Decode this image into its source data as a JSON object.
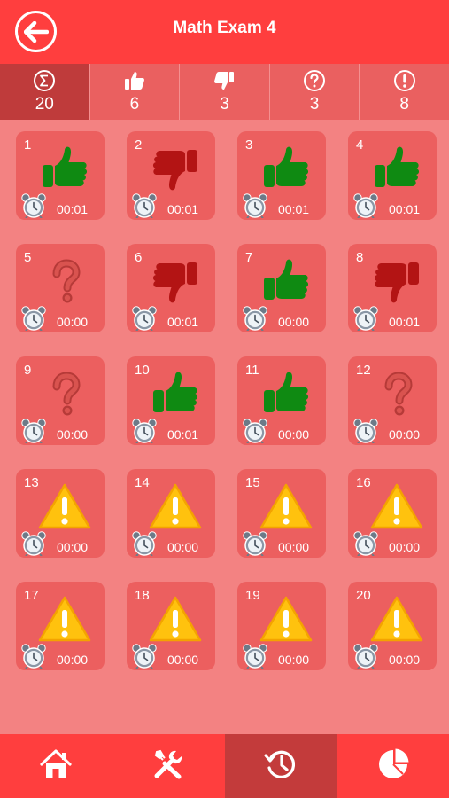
{
  "header": {
    "title": "Math Exam 4",
    "back_icon": "arrow-left-icon"
  },
  "stats": [
    {
      "icon": "sigma-icon",
      "count": "20",
      "active": true
    },
    {
      "icon": "thumbs-up-icon",
      "count": "6",
      "active": false
    },
    {
      "icon": "thumbs-down-icon",
      "count": "3",
      "active": false
    },
    {
      "icon": "question-icon",
      "count": "3",
      "active": false
    },
    {
      "icon": "exclamation-icon",
      "count": "8",
      "active": false
    }
  ],
  "questions": [
    {
      "number": "1",
      "status": "correct",
      "time": "00:01"
    },
    {
      "number": "2",
      "status": "wrong",
      "time": "00:01"
    },
    {
      "number": "3",
      "status": "correct",
      "time": "00:01"
    },
    {
      "number": "4",
      "status": "correct",
      "time": "00:01"
    },
    {
      "number": "5",
      "status": "unsure",
      "time": "00:00"
    },
    {
      "number": "6",
      "status": "wrong",
      "time": "00:01"
    },
    {
      "number": "7",
      "status": "correct",
      "time": "00:00"
    },
    {
      "number": "8",
      "status": "wrong",
      "time": "00:01"
    },
    {
      "number": "9",
      "status": "unsure",
      "time": "00:00"
    },
    {
      "number": "10",
      "status": "correct",
      "time": "00:01"
    },
    {
      "number": "11",
      "status": "correct",
      "time": "00:00"
    },
    {
      "number": "12",
      "status": "unsure",
      "time": "00:00"
    },
    {
      "number": "13",
      "status": "unanswered",
      "time": "00:00"
    },
    {
      "number": "14",
      "status": "unanswered",
      "time": "00:00"
    },
    {
      "number": "15",
      "status": "unanswered",
      "time": "00:00"
    },
    {
      "number": "16",
      "status": "unanswered",
      "time": "00:00"
    },
    {
      "number": "17",
      "status": "unanswered",
      "time": "00:00"
    },
    {
      "number": "18",
      "status": "unanswered",
      "time": "00:00"
    },
    {
      "number": "19",
      "status": "unanswered",
      "time": "00:00"
    },
    {
      "number": "20",
      "status": "unanswered",
      "time": "00:00"
    }
  ],
  "tabs": [
    {
      "icon": "home-icon",
      "active": false
    },
    {
      "icon": "tools-icon",
      "active": false
    },
    {
      "icon": "history-icon",
      "active": true
    },
    {
      "icon": "pie-chart-icon",
      "active": false
    }
  ],
  "colors": {
    "header": "#ff3e3e",
    "background": "#f38282",
    "card": "#ec5f5f",
    "correct": "#0f8a12",
    "wrong": "#b31414",
    "unsure": "#d9534f",
    "warning": "#ffc20e"
  }
}
